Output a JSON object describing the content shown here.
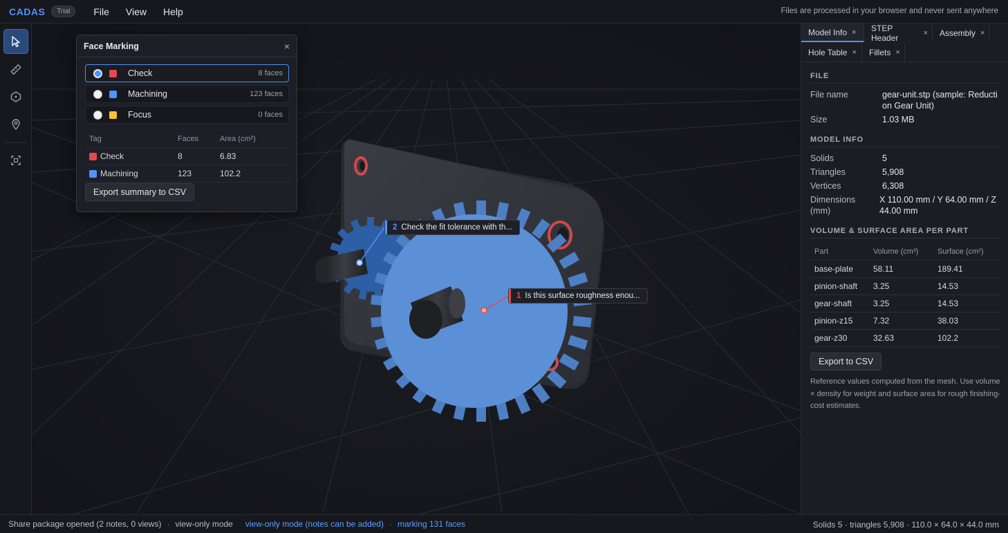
{
  "app": {
    "logo": "CADAS",
    "badge": "Trial",
    "menu": [
      "File",
      "View",
      "Help"
    ],
    "privacy_note": "Files are processed in your browser and never sent anywhere"
  },
  "toolbar": {
    "tools": [
      "select-arrow-icon",
      "ruler-icon",
      "shape-icon",
      "map-pin-icon",
      "fit-view-icon"
    ],
    "active_tool": "select-arrow-icon"
  },
  "face_marking": {
    "title": "Face Marking",
    "close": "×",
    "tags": [
      {
        "label": "Check",
        "count": "8 faces",
        "color": "#e5484d",
        "selected": true
      },
      {
        "label": "Machining",
        "count": "123 faces",
        "color": "#4f93ff",
        "selected": false
      },
      {
        "label": "Focus",
        "count": "0 faces",
        "color": "#f5c32c",
        "selected": false
      }
    ],
    "table_headers": [
      "Tag",
      "Faces",
      "Area (cm²)"
    ],
    "rows": [
      {
        "tag": "Check",
        "faces": "8",
        "area": "6.83",
        "color": "#e5484d"
      },
      {
        "tag": "Machining",
        "faces": "123",
        "area": "102.2",
        "color": "#4f93ff"
      }
    ],
    "export_label": "Export summary to CSV"
  },
  "notes": [
    {
      "num": "2",
      "text": "Check the fit tolerance with th...",
      "color": "#4f93ff"
    },
    {
      "num": "1",
      "text": "Is this surface roughness enou...",
      "color": "#e5484d"
    }
  ],
  "right_panel": {
    "tabs": [
      "Model Info",
      "STEP Header",
      "Assembly",
      "Hole Table",
      "Fillets"
    ],
    "active_tab": "Model Info",
    "file_section": "FILE",
    "file_name_label": "File name",
    "file_name": "gear-unit.stp (sample: Reduction Gear Unit)",
    "size_label": "Size",
    "size": "1.03 MB",
    "model_section": "MODEL INFO",
    "solids_label": "Solids",
    "solids": "5",
    "triangles_label": "Triangles",
    "triangles": "5,908",
    "vertices_label": "Vertices",
    "vertices": "6,308",
    "dimensions_label": "Dimensions (mm)",
    "dimensions": "X 110.00 mm / Y 64.00 mm / Z 44.00 mm",
    "volume_section": "VOLUME & SURFACE AREA PER PART",
    "table_headers": [
      "Part",
      "Volume (cm³)",
      "Surface (cm²)"
    ],
    "parts": [
      {
        "part": "base-plate",
        "volume": "58.11",
        "surface": "189.41"
      },
      {
        "part": "pinion-shaft",
        "volume": "3.25",
        "surface": "14.53"
      },
      {
        "part": "gear-shaft",
        "volume": "3.25",
        "surface": "14.53"
      },
      {
        "part": "pinion-z15",
        "volume": "7.32",
        "surface": "38.03"
      },
      {
        "part": "gear-z30",
        "volume": "32.63",
        "surface": "102.2"
      }
    ],
    "export_label": "Export to CSV",
    "reference_note": "Reference values computed from the mesh. Use volume × density for weight and surface area for rough finishing-cost estimates."
  },
  "status": {
    "left": "Share package opened (2 notes, 0 views)",
    "sep": "·",
    "mode": "view-only mode",
    "mode_blue": "view-only mode (notes can be added)",
    "marking": "marking 131 faces",
    "right": "Solids 5 · triangles 5,908 · 110.0 × 64.0 × 44.0 mm"
  }
}
